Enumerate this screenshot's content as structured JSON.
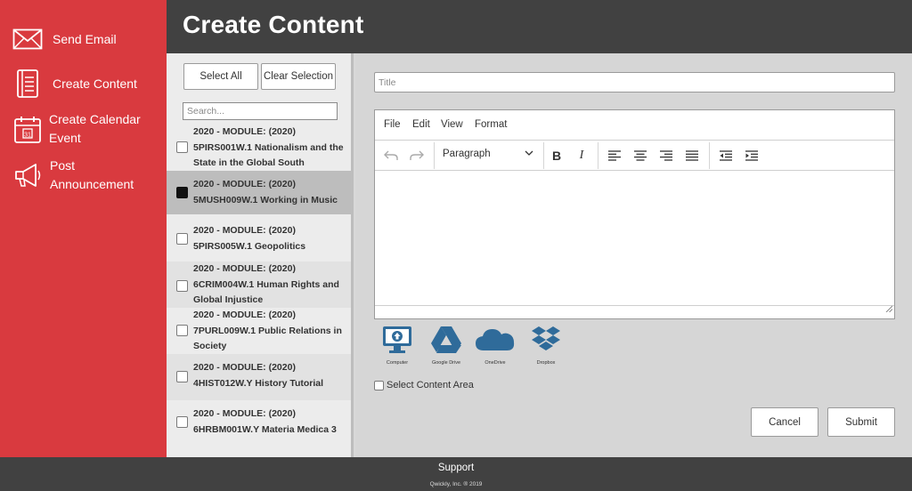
{
  "sidebar": {
    "items": [
      {
        "label": "Send Email",
        "icon": "envelope-icon"
      },
      {
        "label": "Create Content",
        "icon": "document-icon"
      },
      {
        "label": "Create Calendar Event",
        "icon": "calendar-icon"
      },
      {
        "label": "Post Announcement",
        "icon": "megaphone-icon"
      }
    ]
  },
  "header": {
    "title": "Create Content"
  },
  "list": {
    "select_all": "Select All",
    "clear_selection": "Clear Selection",
    "search_placeholder": "Search...",
    "courses": [
      {
        "line1": "2020 - MODULE: (2020)",
        "line2": "5PIRS001W.1 Nationalism and the State in the Global South",
        "checked": false
      },
      {
        "line1": "2020 - MODULE: (2020)",
        "line2": "5MUSH009W.1 Working in Music",
        "checked": true
      },
      {
        "line1": "2020 - MODULE: (2020)",
        "line2": "5PIRS005W.1 Geopolitics",
        "checked": false
      },
      {
        "line1": "2020 - MODULE: (2020)",
        "line2": "6CRIM004W.1 Human Rights and Global Injustice",
        "checked": false
      },
      {
        "line1": "2020 - MODULE: (2020)",
        "line2": "7PURL009W.1 Public Relations in Society",
        "checked": false
      },
      {
        "line1": "2020 - MODULE: (2020)",
        "line2": "4HIST012W.Y History Tutorial",
        "checked": false
      },
      {
        "line1": "2020 - MODULE: (2020)",
        "line2": "6HRBM001W.Y Materia Medica 3",
        "checked": false
      }
    ]
  },
  "editor": {
    "title_placeholder": "Title",
    "menu": [
      "File",
      "Edit",
      "View",
      "Format"
    ],
    "block_format": "Paragraph"
  },
  "attachments": [
    {
      "label": "Computer",
      "icon": "computer-upload-icon"
    },
    {
      "label": "Google Drive",
      "icon": "google-drive-icon"
    },
    {
      "label": "OneDrive",
      "icon": "onedrive-icon"
    },
    {
      "label": "Dropbox",
      "icon": "dropbox-icon"
    }
  ],
  "select_content_area": "Select Content Area",
  "actions": {
    "cancel": "Cancel",
    "submit": "Submit"
  },
  "footer": {
    "support": "Support",
    "copyright": "Qwickly, Inc. ® 2019"
  },
  "colors": {
    "sidebar": "#d93a3f",
    "header": "#414141",
    "icon_blue": "#2f6b9a"
  }
}
